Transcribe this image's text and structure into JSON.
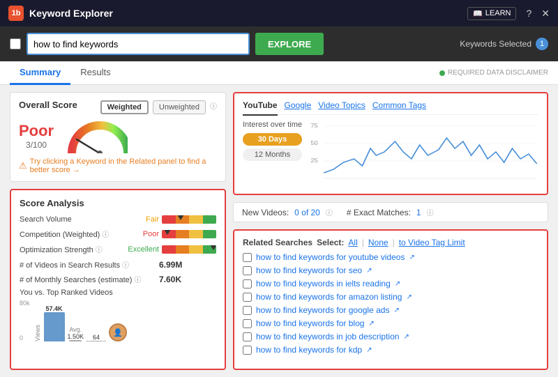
{
  "titleBar": {
    "logo": "1b",
    "title": "Keyword Explorer",
    "learnLabel": "LEARN",
    "helpIcon": "?",
    "closeIcon": "✕"
  },
  "searchBar": {
    "inputValue": "how to find keywords",
    "inputPlaceholder": "how to find keywords",
    "exploreLabel": "EXPLORE",
    "keywordsSelectedLabel": "Keywords Selected",
    "keywordsSelectedCount": "1"
  },
  "tabs": {
    "items": [
      "Summary",
      "Results"
    ],
    "activeTab": "Summary",
    "disclaimer": "REQUIRED DATA DISCLAIMER"
  },
  "overallScore": {
    "title": "Overall Score",
    "weightedLabel": "Weighted",
    "unweightedLabel": "Unweighted",
    "scoreLabel": "Poor",
    "scoreValue": "3/100",
    "tryBetterText": "Try clicking a Keyword in the Related panel to find a better score →"
  },
  "scoreAnalysis": {
    "title": "Score Analysis",
    "metrics": [
      {
        "label": "Search Volume",
        "rating": "Fair",
        "ratingColor": "#f0a000",
        "barPos": 30
      },
      {
        "label": "Competition (Weighted)",
        "rating": "Poor",
        "ratingColor": "#e53e3e",
        "barPos": 5
      },
      {
        "label": "Optimization Strength",
        "rating": "Excellent",
        "ratingColor": "#3eaa4f",
        "barPos": 90
      }
    ],
    "videoResults": {
      "label": "# of Videos in Search Results",
      "value": "6.99M"
    },
    "monthlySearches": {
      "label": "# of Monthly Searches (estimate)",
      "value": "7.60K"
    },
    "youVsTop": {
      "label": "You vs. Top Ranked Videos"
    },
    "viewsData": {
      "yMax": "80k",
      "yMid": "",
      "y0": "0",
      "avgLabel": "Avg.",
      "bars": [
        {
          "label": "57.4K",
          "height": 71,
          "highlight": true
        },
        {
          "label": "1.50K",
          "height": 2,
          "highlight": false
        },
        {
          "label": "64",
          "height": 1,
          "highlight": false
        }
      ]
    }
  },
  "chart": {
    "tabs": [
      "YouTube",
      "Google",
      "Video Topics",
      "Common Tags"
    ],
    "activeTab": "YouTube",
    "timePeriods": [
      "30 Days",
      "12 Months"
    ],
    "activeTime": "30 Days",
    "interestLabel": "Interest over time"
  },
  "newVideos": {
    "label": "New Videos:",
    "value": "0 of 20",
    "exactMatchesLabel": "# Exact Matches:",
    "exactMatchesValue": "1"
  },
  "relatedSearches": {
    "title": "Related Searches",
    "selectLabel": "Select:",
    "links": [
      "All",
      "None",
      "to Video Tag Limit"
    ],
    "items": [
      "how to find keywords for youtube videos",
      "how to find keywords for seo",
      "how to find keywords in ielts reading",
      "how to find keywords for amazon listing",
      "how to find keywords for google ads",
      "how to find keywords for blog",
      "how to find keywords in job description",
      "how to find keywords for kdp"
    ]
  }
}
